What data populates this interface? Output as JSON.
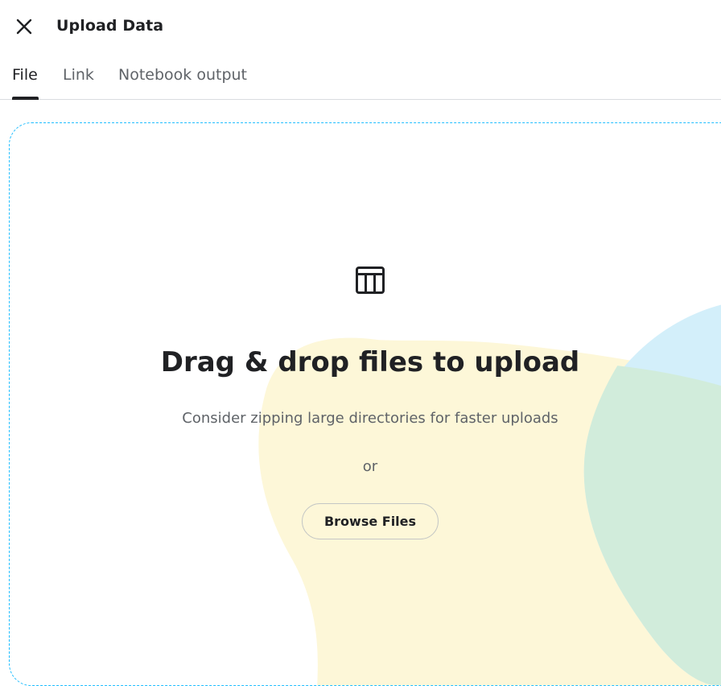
{
  "header": {
    "title": "Upload Data",
    "close_icon": "close-icon"
  },
  "tabs": [
    {
      "label": "File",
      "active": true
    },
    {
      "label": "Link",
      "active": false
    },
    {
      "label": "Notebook output",
      "active": false
    }
  ],
  "dropzone": {
    "icon": "table-icon",
    "headline": "Drag & drop files to upload",
    "subline": "Consider zipping large directories for faster uploads",
    "or_text": "or",
    "browse_label": "Browse Files"
  },
  "colors": {
    "accent_dashed_border": "#20beff",
    "blob_yellow": "#fdf7d8",
    "blob_blue": "#d3effa",
    "blob_green": "#d1ecdb",
    "text_primary": "#202124",
    "text_secondary": "#5f6368"
  }
}
